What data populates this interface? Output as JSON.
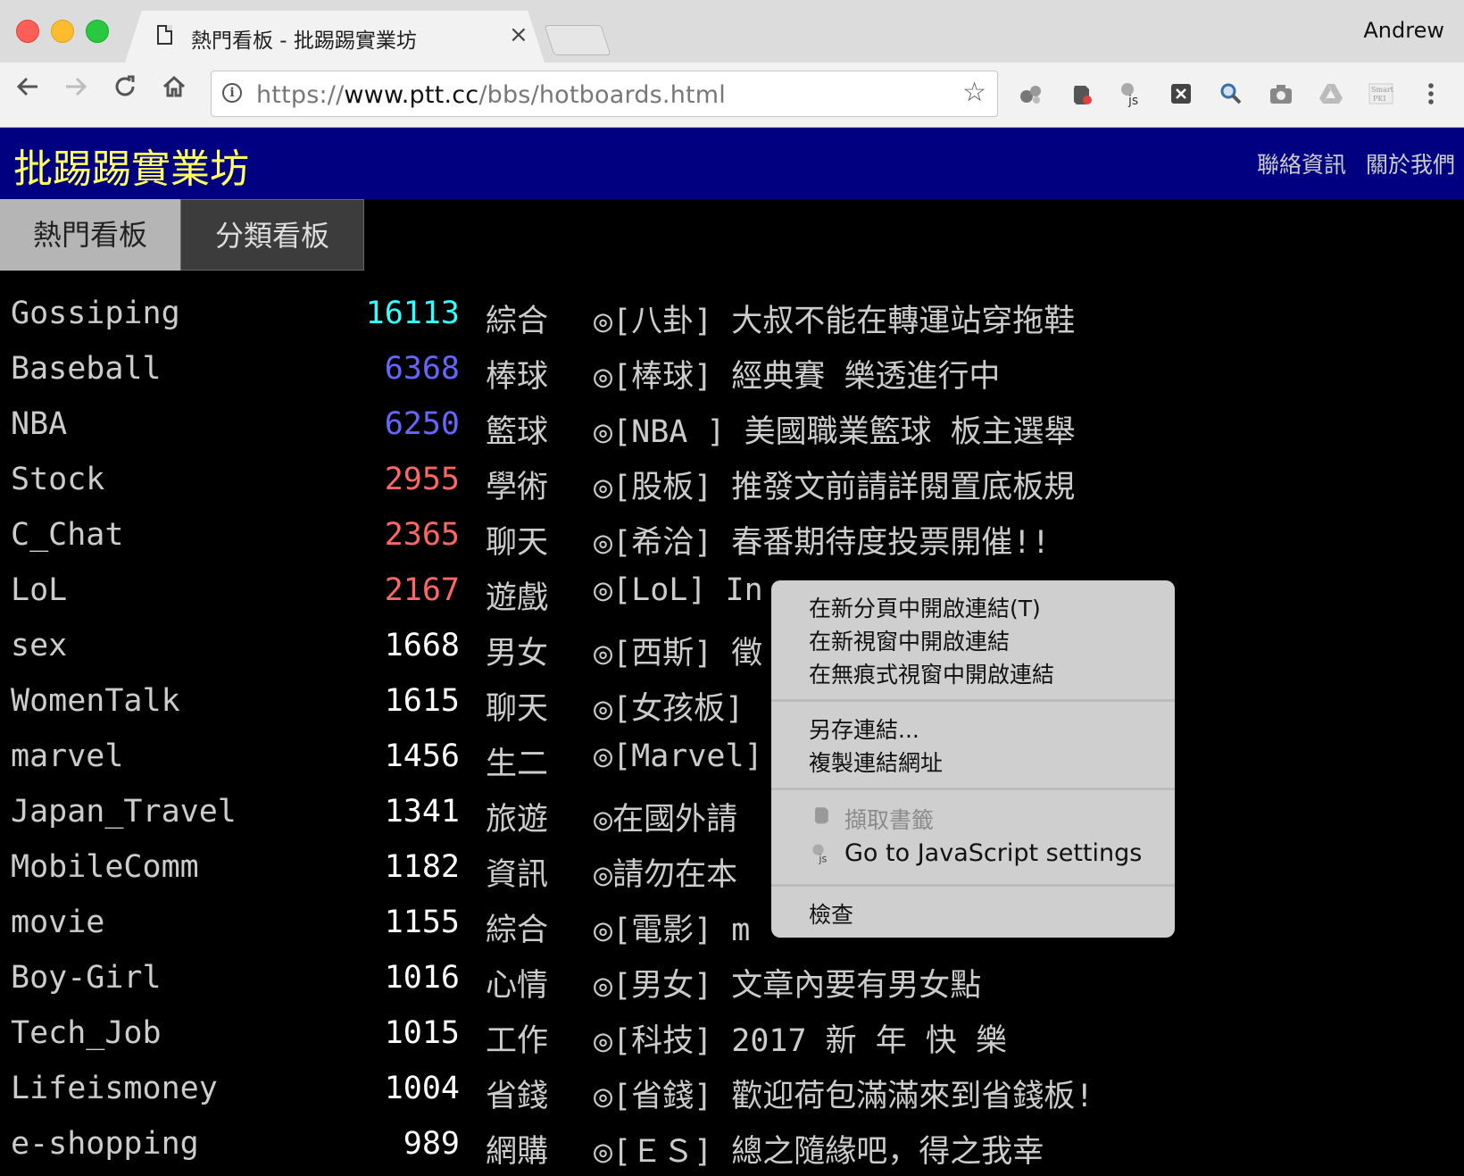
{
  "browser": {
    "tab_title": "熱門看板 - 批踢踢實業坊",
    "tab_close": "×",
    "profile": "Andrew",
    "url_scheme": "https://",
    "url_host": "www.ptt.cc",
    "url_path": "/bbs/hotboards.html",
    "extensions": [
      "extension-icon",
      "evernote-icon",
      "js-settings-icon",
      "x-extension-icon",
      "search-extension-icon",
      "camera-icon",
      "drive-icon",
      "smartpki-icon",
      "menu-icon"
    ]
  },
  "site": {
    "logo": "批踢踢實業坊",
    "links": [
      "聯絡資訊",
      "關於我們"
    ],
    "tabs": [
      "熱門看板",
      "分類看板"
    ]
  },
  "colors": {
    "header_bg": "#000080",
    "logo": "#ffff60",
    "count_cyan": "#33ffff",
    "count_blue": "#6666ff",
    "count_red": "#ff6666",
    "count_white": "#ffffff"
  },
  "boards": [
    {
      "name": "Gossiping",
      "count": "16113",
      "color": "#33ffff",
      "class": "綜合",
      "title": "◎[八卦] 大叔不能在轉運站穿拖鞋"
    },
    {
      "name": "Baseball",
      "count": "6368",
      "color": "#6666ff",
      "class": "棒球",
      "title": "◎[棒球] 經典賽 樂透進行中"
    },
    {
      "name": "NBA",
      "count": "6250",
      "color": "#6666ff",
      "class": "籃球",
      "title": "◎[NBA ] 美國職業籃球 板主選舉"
    },
    {
      "name": "Stock",
      "count": "2955",
      "color": "#ff6666",
      "class": "學術",
      "title": "◎[股板] 推發文前請詳閱置底板規"
    },
    {
      "name": "C_Chat",
      "count": "2365",
      "color": "#ff6666",
      "class": "聊天",
      "title": "◎[希洽] 春番期待度投票開催!!"
    },
    {
      "name": "LoL",
      "count": "2167",
      "color": "#ff6666",
      "class": "遊戲",
      "title": "◎[LoL] In"
    },
    {
      "name": "sex",
      "count": "1668",
      "color": "#ffffff",
      "class": "男女",
      "title": "◎[西斯] 徵"
    },
    {
      "name": "WomenTalk",
      "count": "1615",
      "color": "#ffffff",
      "class": "聊天",
      "title": "◎[女孩板]"
    },
    {
      "name": "marvel",
      "count": "1456",
      "color": "#ffffff",
      "class": "生二",
      "title": "◎[Marvel]"
    },
    {
      "name": "Japan_Travel",
      "count": "1341",
      "color": "#ffffff",
      "class": "旅遊",
      "title": "◎在國外請"
    },
    {
      "name": "MobileComm",
      "count": "1182",
      "color": "#ffffff",
      "class": "資訊",
      "title": "◎請勿在本"
    },
    {
      "name": "movie",
      "count": "1155",
      "color": "#ffffff",
      "class": "綜合",
      "title": "◎[電影] m"
    },
    {
      "name": "Boy-Girl",
      "count": "1016",
      "color": "#ffffff",
      "class": "心情",
      "title": "◎[男女] 文章內要有男女點"
    },
    {
      "name": "Tech_Job",
      "count": "1015",
      "color": "#ffffff",
      "class": "工作",
      "title": "◎[科技] 2017 新 年 快 樂"
    },
    {
      "name": "Lifeismoney",
      "count": "1004",
      "color": "#ffffff",
      "class": "省錢",
      "title": "◎[省錢] 歡迎荷包滿滿來到省錢板!"
    },
    {
      "name": "e-shopping",
      "count": "989",
      "color": "#ffffff",
      "class": "網購",
      "title": "◎[ＥＳ] 總之隨緣吧，得之我幸"
    }
  ],
  "context_menu": {
    "open_new_tab": "在新分頁中開啟連結(T)",
    "open_new_window": "在新視窗中開啟連結",
    "open_incognito": "在無痕式視窗中開啟連結",
    "save_link": "另存連結...",
    "copy_link": "複製連結網址",
    "clip_bookmark": "擷取書籤",
    "js_settings": "Go to JavaScript settings",
    "inspect": "檢查"
  }
}
